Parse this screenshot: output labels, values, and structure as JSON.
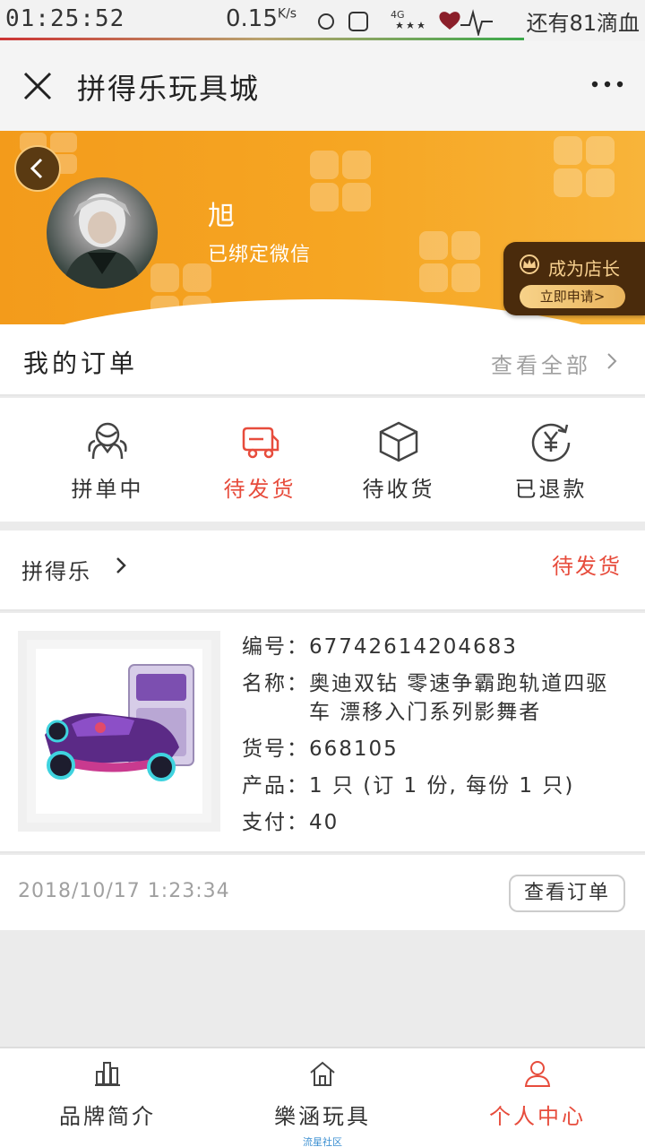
{
  "status_bar": {
    "time": "01:25:52",
    "speed": "0.15",
    "speed_unit": "K/s",
    "battery_text": "还有81滴血"
  },
  "titlebar": {
    "title": "拼得乐玩具城"
  },
  "profile": {
    "name": "旭",
    "bind_status": "已绑定微信",
    "manager_title": "成为店长",
    "manager_button": "立即申请>"
  },
  "orders": {
    "title": "我的订单",
    "view_all": "查看全部",
    "statuses": [
      {
        "label": "拼单中",
        "icon": "group-icon"
      },
      {
        "label": "待发货",
        "icon": "truck-icon"
      },
      {
        "label": "待收货",
        "icon": "box-icon"
      },
      {
        "label": "已退款",
        "icon": "refund-icon"
      }
    ]
  },
  "order_card": {
    "shop": "拼得乐",
    "status": "待发货",
    "number_label": "编号：",
    "number": "67742614204683",
    "name_label": "名称：",
    "name": "奥迪双钻 零速争霸跑轨道四驱车 漂移入门系列影舞者",
    "sku_label": "货号：",
    "sku": "668105",
    "product_label": "产品：",
    "product": "1 只 (订 1 份, 每份 1 只)",
    "pay_label": "支付：",
    "pay": "40",
    "date": "2018/10/17 1:23:34",
    "view_button": "查看订单"
  },
  "bottom_nav": {
    "items": [
      {
        "label": "品牌简介",
        "icon": "chart-icon"
      },
      {
        "label": "樂涵玩具",
        "icon": "home-icon",
        "sub": "流星社区"
      },
      {
        "label": "个人中心",
        "icon": "user-icon"
      }
    ]
  },
  "colors": {
    "accent": "#e74c3c",
    "header_orange": "#f6a623"
  }
}
